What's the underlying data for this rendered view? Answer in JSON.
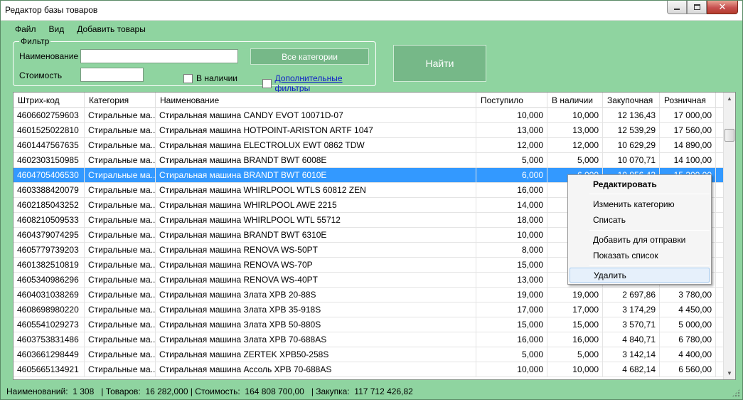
{
  "window": {
    "title": "Редактор базы товаров"
  },
  "menu": {
    "file": "Файл",
    "view": "Вид",
    "add": "Добавить товары"
  },
  "filter": {
    "legend": "Фильтр",
    "name_label": "Наименование",
    "name_value": "",
    "cost_label": "Стоимость",
    "cost_value": "",
    "categories_button": "Все категории",
    "in_stock_label": "В наличии",
    "extra_filters_label": "Дополнительные фильтры"
  },
  "find_button": "Найти",
  "table": {
    "columns": [
      "Штрих-код",
      "Категория",
      "Наименование",
      "Поступило",
      "В наличии",
      "Закупочная",
      "Розничная"
    ],
    "rows": [
      [
        "4606602759603",
        "Стиральные ма...",
        "Стиральная машина CANDY EVOT 10071D-07",
        "10,000",
        "10,000",
        "12 136,43",
        "17 000,00"
      ],
      [
        "4601525022810",
        "Стиральные ма...",
        "Стиральная машина HOTPOINT-ARISTON ARTF 1047",
        "13,000",
        "13,000",
        "12 539,29",
        "17 560,00"
      ],
      [
        "4601447567635",
        "Стиральные ма...",
        "Стиральная машина ELECTROLUX EWT 0862 TDW",
        "12,000",
        "12,000",
        "10 629,29",
        "14 890,00"
      ],
      [
        "4602303150985",
        "Стиральные ма...",
        "Стиральная машина BRANDT BWT 6008E",
        "5,000",
        "5,000",
        "10 070,71",
        "14 100,00"
      ],
      [
        "4604705406530",
        "Стиральные ма...",
        "Стиральная машина BRANDT BWT 6010E",
        "6,000",
        "6,000",
        "10 856,43",
        "15 200,00"
      ],
      [
        "4603388420079",
        "Стиральные ма...",
        "Стиральная машина WHIRLPOOL WTLS 60812 ZEN",
        "16,000",
        "",
        "",
        ""
      ],
      [
        "4602185043252",
        "Стиральные ма...",
        "Стиральная машина WHIRLPOOL AWE 2215",
        "14,000",
        "",
        "",
        ""
      ],
      [
        "4608210509533",
        "Стиральные ма...",
        "Стиральная машина WHIRLPOOL WTL 55712",
        "18,000",
        "",
        "",
        ""
      ],
      [
        "4604379074295",
        "Стиральные ма...",
        "Стиральная машина BRANDT BWT 6310E",
        "10,000",
        "",
        "",
        ""
      ],
      [
        "4605779739203",
        "Стиральные ма...",
        "Стиральная машина RENOVA WS-50PT",
        "8,000",
        "",
        "",
        ""
      ],
      [
        "4601382510819",
        "Стиральные ма...",
        "Стиральная машина RENOVA WS-70P",
        "15,000",
        "",
        "",
        ""
      ],
      [
        "4605340986296",
        "Стиральные ма...",
        "Стиральная машина RENOVA WS-40PT",
        "13,000",
        "",
        "",
        ""
      ],
      [
        "4604031038269",
        "Стиральные ма...",
        "Стиральная машина Злата XPB 20-88S",
        "19,000",
        "19,000",
        "2 697,86",
        "3 780,00"
      ],
      [
        "4608698980220",
        "Стиральные ма...",
        "Стиральная машина Злата XPB 35-918S",
        "17,000",
        "17,000",
        "3 174,29",
        "4 450,00"
      ],
      [
        "4605541029273",
        "Стиральные ма...",
        "Стиральная машина Злата XPB 50-880S",
        "15,000",
        "15,000",
        "3 570,71",
        "5 000,00"
      ],
      [
        "4603753831486",
        "Стиральные ма...",
        "Стиральная машина Злата XPB 70-688AS",
        "16,000",
        "16,000",
        "4 840,71",
        "6 780,00"
      ],
      [
        "4603661298449",
        "Стиральные ма...",
        "Стиральная машина ZERTEK XPB50-258S",
        "5,000",
        "5,000",
        "3 142,14",
        "4 400,00"
      ],
      [
        "4605665134921",
        "Стиральные ма...",
        "Стиральная машина Ассоль XPB 70-688AS",
        "10,000",
        "10,000",
        "4 682,14",
        "6 560,00"
      ]
    ],
    "selected_row": 4
  },
  "context_menu": {
    "edit": "Редактировать",
    "change_category": "Изменить категорию",
    "write_off": "Списать",
    "add_to_shipment": "Добавить для отправки",
    "show_list": "Показать список",
    "delete": "Удалить"
  },
  "status": {
    "names_label": "Наименований:",
    "names_value": "1 308",
    "goods_label": "| Товаров:",
    "goods_value": "16 282,000",
    "cost_label": "| Стоимость:",
    "cost_value": "164 808 700,00",
    "purchase_label": "| Закупка:",
    "purchase_value": "117 712 426,82"
  },
  "colors": {
    "window_bg": "#8fd4a0",
    "button_bg": "#76b888",
    "selection": "#3399ff"
  },
  "icons": {
    "minimize": "minimize-icon",
    "maximize": "maximize-icon",
    "close": "close-icon"
  }
}
